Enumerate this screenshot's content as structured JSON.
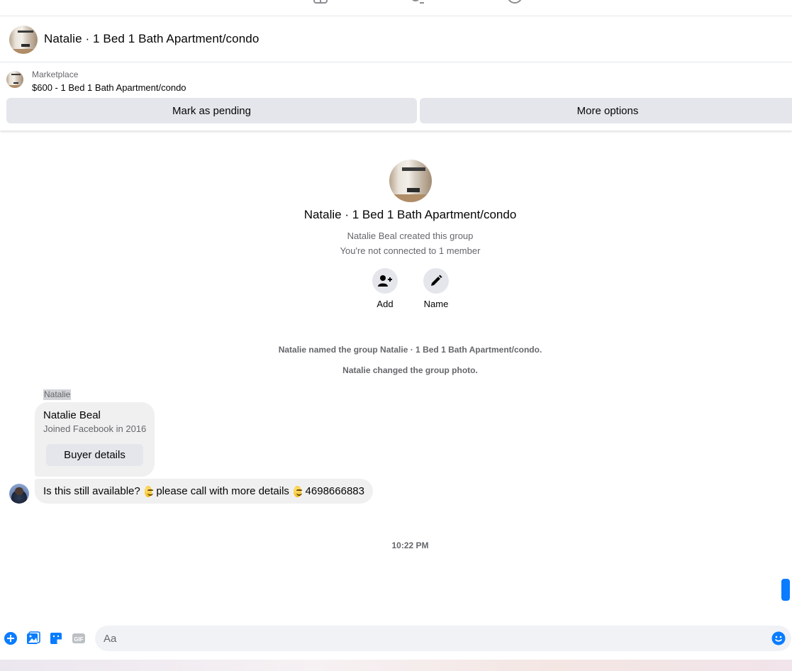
{
  "header": {
    "title": "Natalie · 1 Bed 1 Bath Apartment/condo"
  },
  "listing": {
    "label": "Marketplace",
    "item": "$600 - 1 Bed 1 Bath Apartment/condo",
    "buttons": {
      "pending": "Mark as pending",
      "more": "More options"
    }
  },
  "intro": {
    "title": "Natalie · 1 Bed 1 Bath Apartment/condo",
    "created": "Natalie Beal created this group",
    "connected": "You're not connected to 1 member",
    "actions": {
      "add": "Add",
      "name": "Name"
    }
  },
  "system_messages": {
    "named": "Natalie named the group Natalie · 1 Bed 1 Bath Apartment/condo.",
    "photo": "Natalie changed the group photo."
  },
  "conversation": {
    "sender": "Natalie",
    "card": {
      "name": "Natalie Beal",
      "joined": "Joined Facebook in 2016",
      "button": "Buyer details"
    },
    "message": {
      "part1": "Is this still available?",
      "part2": "please call with more details",
      "part3": "4698666883"
    },
    "timestamp": "10:22 PM"
  },
  "composer": {
    "placeholder": "Aa"
  },
  "colors": {
    "accent": "#0a7cff",
    "bubble": "#f0f0f0",
    "button_bg": "#e4e6eb",
    "secondary_text": "#65676b"
  },
  "icons": {
    "top_nav": [
      "marketplace-icon",
      "people-icon",
      "account-icon"
    ],
    "composer": [
      "plus-icon",
      "photo-icon",
      "sticker-icon",
      "gif-icon",
      "emoji-icon"
    ]
  }
}
